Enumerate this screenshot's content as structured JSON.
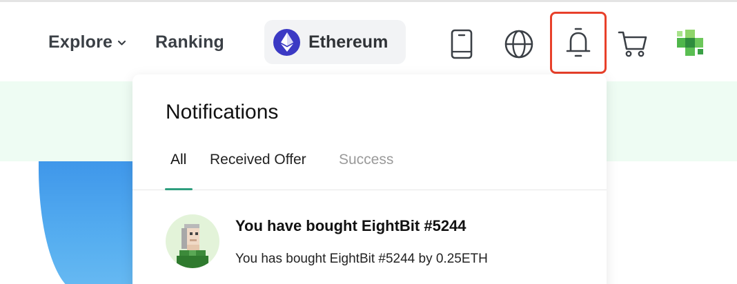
{
  "nav": {
    "explore_label": "Explore",
    "ranking_label": "Ranking",
    "chain_label": "Ethereum"
  },
  "icons": {
    "explore_chevron": "chevron-down-icon",
    "chain": "ethereum-icon",
    "mobile": "mobile-icon",
    "language": "globe-icon",
    "notifications": "bell-icon",
    "cart": "cart-icon",
    "account": "avatar-icon"
  },
  "colors": {
    "accent": "#2e9e7e",
    "highlight": "#e8402a",
    "ethereum": "#3b39c4",
    "hero_band": "#eefcf3"
  },
  "notifications": {
    "title": "Notifications",
    "tabs": [
      {
        "label": "All",
        "active": true
      },
      {
        "label": "Received Offer",
        "active": false
      },
      {
        "label": "Success",
        "active": false
      }
    ],
    "items": [
      {
        "title": "You have bought EightBit #5244",
        "description": "You has bought EightBit #5244 by 0.25ETH"
      }
    ]
  }
}
